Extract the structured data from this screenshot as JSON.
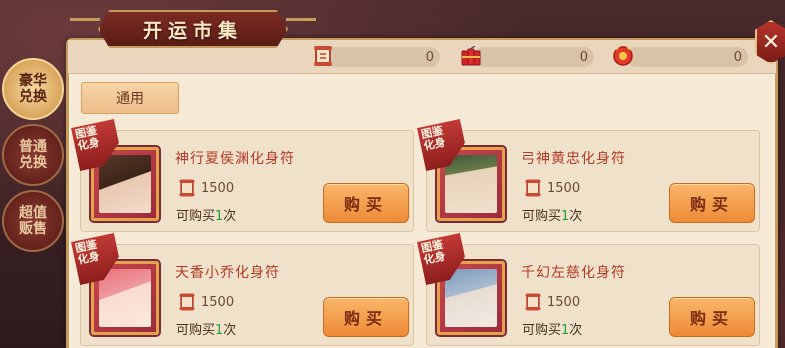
{
  "title": "开运市集",
  "currencies": [
    {
      "icon": "scroll-token-icon",
      "value": "0"
    },
    {
      "icon": "firecracker-icon",
      "value": "0"
    },
    {
      "icon": "red-envelope-icon",
      "value": "0"
    }
  ],
  "side_tabs": [
    {
      "label": "豪华兑换",
      "active": true
    },
    {
      "label": "普通兑换",
      "active": false
    },
    {
      "label": "超值贩售",
      "active": false
    }
  ],
  "sub_tab": "通用",
  "items": [
    {
      "name": "神行夏侯渊化身符",
      "tag_top": "图鉴",
      "tag_bottom": "化身",
      "price": "1500",
      "limit_prefix": "可购买",
      "limit_num": "1",
      "limit_suffix": "次",
      "buy_label": "购买"
    },
    {
      "name": "弓神黄忠化身符",
      "tag_top": "图鉴",
      "tag_bottom": "化身",
      "price": "1500",
      "limit_prefix": "可购买",
      "limit_num": "1",
      "limit_suffix": "次",
      "buy_label": "购买"
    },
    {
      "name": "天香小乔化身符",
      "tag_top": "图鉴",
      "tag_bottom": "化身",
      "price": "1500",
      "limit_prefix": "可购买",
      "limit_num": "1",
      "limit_suffix": "次",
      "buy_label": "购买"
    },
    {
      "name": "千幻左慈化身符",
      "tag_top": "图鉴",
      "tag_bottom": "化身",
      "price": "1500",
      "limit_prefix": "可购买",
      "limit_num": "1",
      "limit_suffix": "次",
      "buy_label": "购买"
    }
  ],
  "colors": {
    "accent": "#ee8a36",
    "title_banner": "#7b2b22",
    "panel": "#f6ead7",
    "name_text": "#b23a26",
    "limit_num": "#2c9a3c"
  }
}
